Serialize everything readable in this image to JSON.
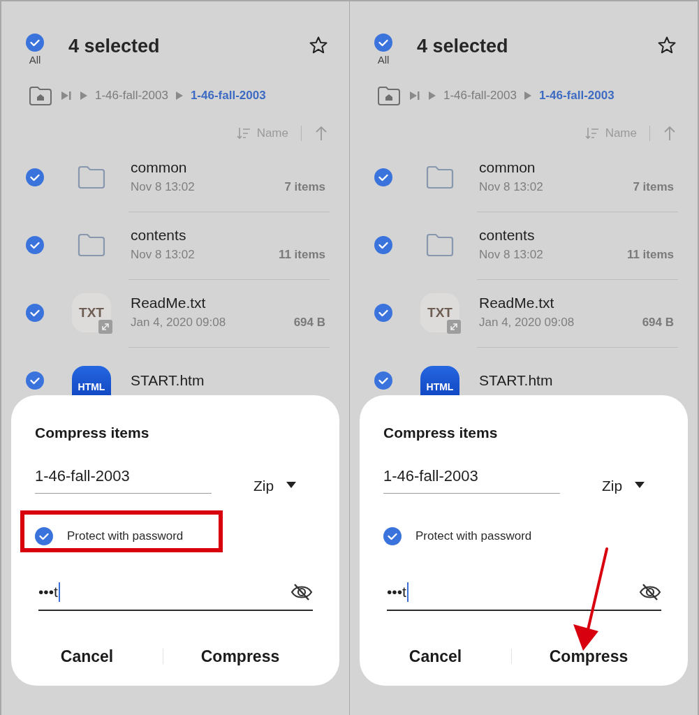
{
  "panels": [
    {
      "select_all": {
        "label": "All",
        "checked": true
      },
      "title": "4 selected",
      "breadcrumb": [
        {
          "label": "1-46-fall-2003",
          "current": false
        },
        {
          "label": "1-46-fall-2003",
          "current": true
        }
      ],
      "sort": {
        "label": "Name"
      },
      "files": [
        {
          "kind": "folder",
          "name": "common",
          "date": "Nov 8 13:02",
          "size": "7 items",
          "checked": true
        },
        {
          "kind": "folder",
          "name": "contents",
          "date": "Nov 8 13:02",
          "size": "11 items",
          "checked": true
        },
        {
          "kind": "txt",
          "icon_text": "TXT",
          "name": "ReadMe.txt",
          "date": "Jan 4, 2020 09:08",
          "size": "694 B",
          "checked": true
        },
        {
          "kind": "html",
          "icon_text": "HTML",
          "name": "START.htm",
          "checked": true
        }
      ],
      "dialog": {
        "title": "Compress items",
        "filename": "1-46-fall-2003",
        "format": "Zip",
        "protect": {
          "label": "Protect with password",
          "checked": true
        },
        "password": "•••t",
        "buttons": [
          "Cancel",
          "Compress"
        ]
      },
      "annotation": {
        "kind": "box"
      }
    },
    {
      "select_all": {
        "label": "All",
        "checked": true
      },
      "title": "4 selected",
      "breadcrumb": [
        {
          "label": "1-46-fall-2003",
          "current": false
        },
        {
          "label": "1-46-fall-2003",
          "current": true
        }
      ],
      "sort": {
        "label": "Name"
      },
      "files": [
        {
          "kind": "folder",
          "name": "common",
          "date": "Nov 8 13:02",
          "size": "7 items",
          "checked": true
        },
        {
          "kind": "folder",
          "name": "contents",
          "date": "Nov 8 13:02",
          "size": "11 items",
          "checked": true
        },
        {
          "kind": "txt",
          "icon_text": "TXT",
          "name": "ReadMe.txt",
          "date": "Jan 4, 2020 09:08",
          "size": "694 B",
          "checked": true
        },
        {
          "kind": "html",
          "icon_text": "HTML",
          "name": "START.htm",
          "checked": true
        }
      ],
      "dialog": {
        "title": "Compress items",
        "filename": "1-46-fall-2003",
        "format": "Zip",
        "protect": {
          "label": "Protect with password",
          "checked": true
        },
        "password": "•••t",
        "buttons": [
          "Cancel",
          "Compress"
        ]
      },
      "annotation": {
        "kind": "arrow"
      }
    }
  ]
}
